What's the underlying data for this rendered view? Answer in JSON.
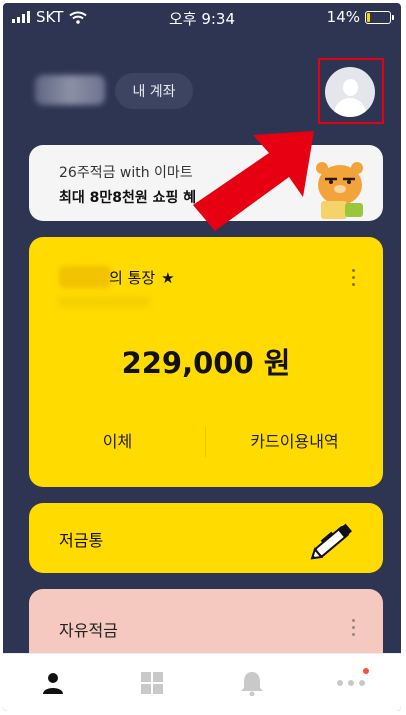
{
  "status_bar": {
    "carrier": "SKT",
    "time": "오후 9:34",
    "battery": "14%",
    "battery_level": 0.14
  },
  "header": {
    "account_button_label": "내 계좌"
  },
  "promo_banner": {
    "line1": "26주적금 with 이마트",
    "line2": "최대 8만8천원 쇼핑 혜"
  },
  "main_account": {
    "title_suffix": "의 통장",
    "favorite_icon": "★",
    "balance": "229,000 원",
    "action_transfer": "이체",
    "action_card_history": "카드이용내역"
  },
  "piggy_bank": {
    "label": "저금통"
  },
  "free_savings": {
    "label": "자유적금"
  },
  "bottom_nav": {
    "tabs": [
      "person-icon",
      "grid-icon",
      "bell-icon",
      "more-icon"
    ],
    "badge_color": "#ff4b3a"
  },
  "colors": {
    "background": "#2d3553",
    "account_card": "#ffdb00",
    "savings_card": "#f5c9c0",
    "highlight": "#e60012"
  }
}
